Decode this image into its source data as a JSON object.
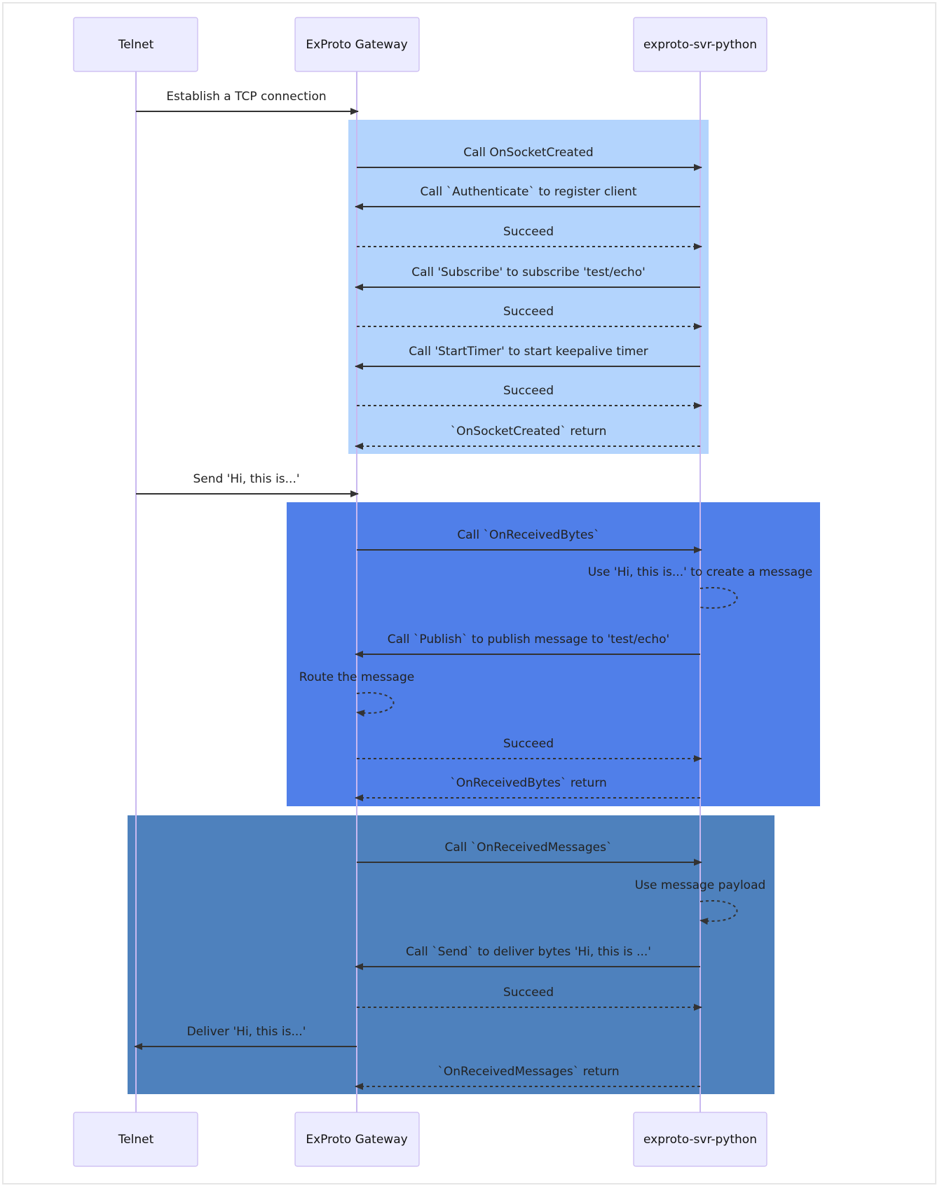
{
  "diagram": {
    "type": "sequence",
    "actors": [
      {
        "id": "telnet",
        "label": "Telnet"
      },
      {
        "id": "gateway",
        "label": "ExProto Gateway"
      },
      {
        "id": "python",
        "label": "exproto-svr-python"
      }
    ],
    "regions": [
      {
        "name": "socket-created-block",
        "color": "#b3d4fd",
        "from": "gateway",
        "to": "python"
      },
      {
        "name": "received-bytes-block",
        "color": "#507fe9",
        "from": "telnet-gateway-mid",
        "to": "python-right"
      },
      {
        "name": "received-messages-block",
        "color": "#4e81bd",
        "from": "telnet",
        "to": "python"
      }
    ],
    "messages": [
      {
        "from": "telnet",
        "to": "gateway",
        "text": "Establish a TCP connection",
        "style": "solid"
      },
      {
        "from": "gateway",
        "to": "python",
        "text": "Call OnSocketCreated",
        "style": "solid",
        "region": 0
      },
      {
        "from": "python",
        "to": "gateway",
        "text": "Call `Authenticate` to register client",
        "style": "solid",
        "region": 0
      },
      {
        "from": "gateway",
        "to": "python",
        "text": "Succeed",
        "style": "dashed",
        "region": 0
      },
      {
        "from": "python",
        "to": "gateway",
        "text": "Call 'Subscribe' to subscribe 'test/echo'",
        "style": "solid",
        "region": 0
      },
      {
        "from": "gateway",
        "to": "python",
        "text": "Succeed",
        "style": "dashed",
        "region": 0
      },
      {
        "from": "python",
        "to": "gateway",
        "text": "Call 'StartTimer' to start keepalive timer",
        "style": "solid",
        "region": 0
      },
      {
        "from": "gateway",
        "to": "python",
        "text": "Succeed",
        "style": "dashed",
        "region": 0
      },
      {
        "from": "python",
        "to": "gateway",
        "text": "`OnSocketCreated` return",
        "style": "dashed",
        "region": 0
      },
      {
        "from": "telnet",
        "to": "gateway",
        "text": "Send 'Hi, this is...'",
        "style": "solid"
      },
      {
        "from": "gateway",
        "to": "python",
        "text": "Call `OnReceivedBytes`",
        "style": "solid",
        "region": 1
      },
      {
        "from": "python",
        "to": "python",
        "text": "Use 'Hi, this is...' to create a message",
        "style": "dashed-open",
        "region": 1
      },
      {
        "from": "python",
        "to": "gateway",
        "text": "Call `Publish` to publish message to 'test/echo'",
        "style": "solid",
        "region": 1
      },
      {
        "from": "gateway",
        "to": "gateway",
        "text": "Route the message",
        "style": "dashed",
        "region": 1
      },
      {
        "from": "gateway",
        "to": "python",
        "text": "Succeed",
        "style": "dashed",
        "region": 1
      },
      {
        "from": "python",
        "to": "gateway",
        "text": "`OnReceivedBytes` return",
        "style": "dashed",
        "region": 1
      },
      {
        "from": "gateway",
        "to": "python",
        "text": "Call `OnReceivedMessages`",
        "style": "solid",
        "region": 2
      },
      {
        "from": "python",
        "to": "python",
        "text": "Use message payload",
        "style": "dashed",
        "region": 2
      },
      {
        "from": "python",
        "to": "gateway",
        "text": "Call `Send` to deliver bytes 'Hi, this is ...'",
        "style": "solid",
        "region": 2
      },
      {
        "from": "gateway",
        "to": "python",
        "text": "Succeed",
        "style": "dashed",
        "region": 2
      },
      {
        "from": "gateway",
        "to": "telnet",
        "text": "Deliver 'Hi, this is...'",
        "style": "solid",
        "region": 2
      },
      {
        "from": "python",
        "to": "gateway",
        "text": "`OnReceivedMessages` return",
        "style": "dashed",
        "region": 2
      }
    ]
  }
}
